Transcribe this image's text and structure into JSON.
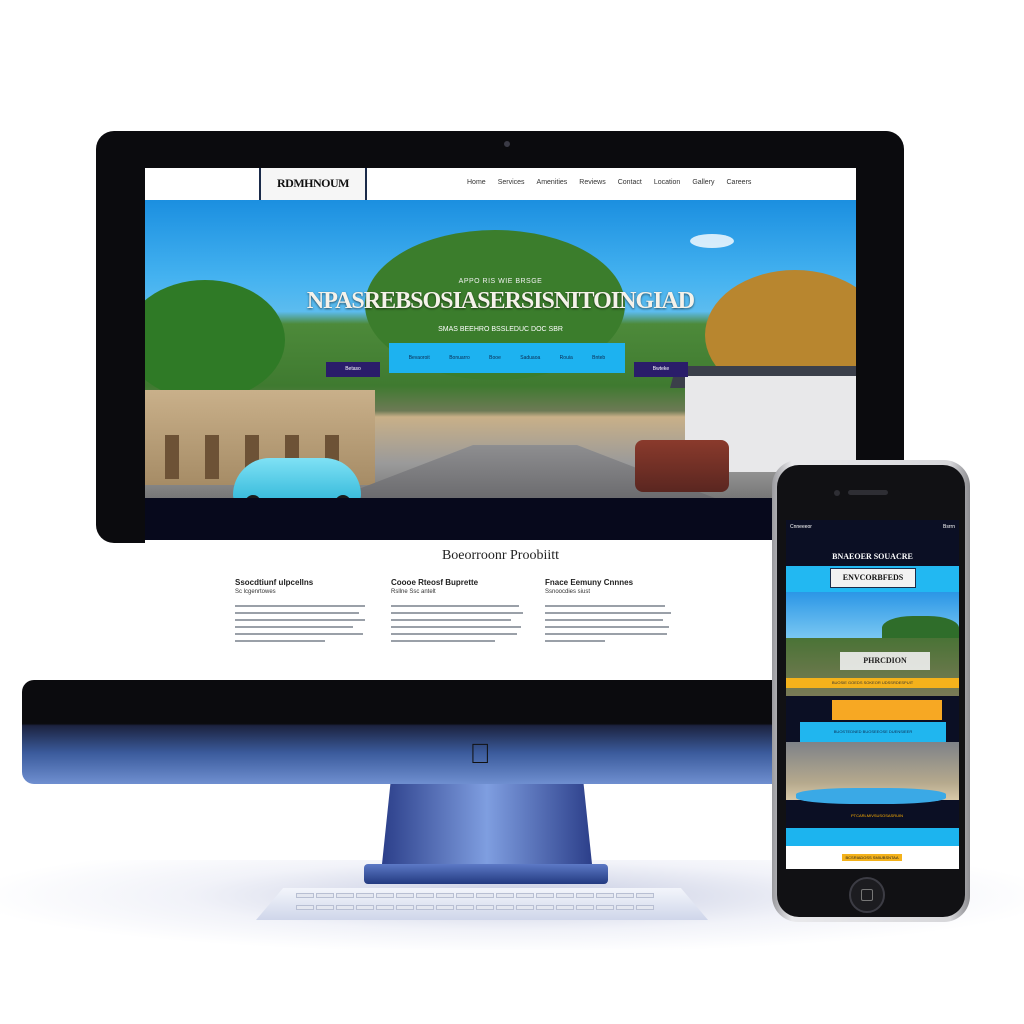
{
  "desktop": {
    "logo": {
      "top_text": "",
      "main_text": "RDMHNOUM",
      "sub_text": ""
    },
    "nav": {
      "items": [
        "Home",
        "Services",
        "Amenities",
        "Reviews",
        "Contact",
        "Location",
        "Gallery",
        "Careers"
      ]
    },
    "hero": {
      "kicker": "APPO RIS WIE BRSGE",
      "title": "NPASREBSOSIASERSISNITOINGIAD",
      "subtitle": "SMAS BEEHRO BSSLEDUC DOC SBR",
      "cta_items": [
        "Bevaoroit",
        "Bonuarro",
        "Booe",
        "Saduaoa",
        "Rouia",
        "Bnteb"
      ],
      "cta_left": "Betaso",
      "cta_right": "Bwteke"
    },
    "content": {
      "section_title": "Boeorroonr Proobiitt",
      "columns": [
        {
          "heading": "Ssocdtiunf ulpcellns",
          "subheading": "Sc lcgenrtowes"
        },
        {
          "heading": "Coooe Rteosf Buprette",
          "subheading": "Rsllne Ssc antelt"
        },
        {
          "heading": "Fnace Eemuny Cnnnes",
          "subheading": "Ssnoocdies siust"
        }
      ]
    }
  },
  "phone": {
    "status_left": "Cnneeeor",
    "status_right": "Bsrrn",
    "title": "BNAEOER SOUACRE",
    "logo_text": "ENVCORBFEDS",
    "hero_title": "PHRCDION",
    "orange_strip_text": "BUOSIE GOEDS SOKEOR UDSSRDESPUIT",
    "cyan_bar_text": "BUOSTEDNED BUOSEEOSE DUENSIEER",
    "button_1": "PTCARLMIVSUSOSASRUIN",
    "button_2": "BCSRIADOSS SMIUBSNTAA"
  },
  "colors": {
    "accent": "#1db2f0",
    "dark": "#07091c",
    "highlight": "#f4b21b"
  }
}
